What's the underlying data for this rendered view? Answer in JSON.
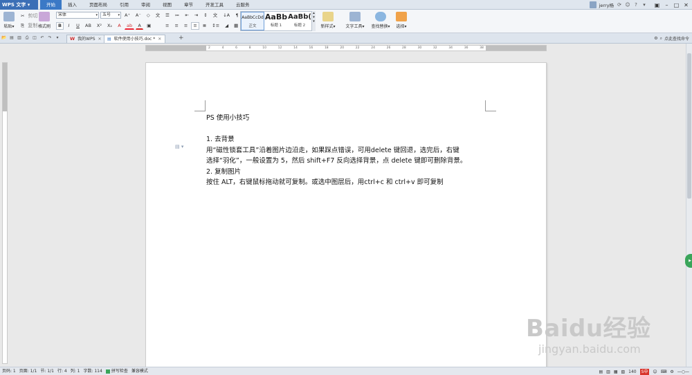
{
  "app": {
    "name": "WPS 文字"
  },
  "menu_tabs": [
    "开始",
    "插入",
    "页面布局",
    "引用",
    "审阅",
    "视图",
    "章节",
    "开发工具",
    "云服务"
  ],
  "title_right": {
    "user": "jerry杨"
  },
  "ribbon": {
    "paste": "粘贴",
    "cut": "剪切",
    "copy": "复制",
    "format_painter": "格式刷",
    "font_name": "宋体",
    "font_size": "五号",
    "styles": [
      {
        "preview": "AaBbCcDd",
        "name": "正文"
      },
      {
        "preview": "AaBb",
        "name": "标题 1"
      },
      {
        "preview": "AaBb(",
        "name": "标题 2"
      }
    ],
    "new_style": "新样式",
    "text_tools": "文字工具",
    "find_replace": "查找替换",
    "select": "选择"
  },
  "doc_tabs": [
    {
      "label": "我的WPS"
    },
    {
      "label": "软件使用小技巧.doc *"
    }
  ],
  "tabbar_right": {
    "search": "点此查找命令"
  },
  "document": {
    "title": "PS 使用小技巧",
    "lines": [
      "1.  去背景",
      "用“磁性锁套工具”沿着图片边沿走，如果踩点错误，可用delete 键回退，选完后，右键",
      "选择“羽化”，一般设置为 5，然后 shift+F7 反向选择背景，点 delete 键即可删除背景。",
      "2.  复制图片",
      "按住 ALT，右键鼠标拖动就可复制。或选中图层后，用ctrl+c 和 ctrl+v 即可复制"
    ]
  },
  "status": {
    "page_num": "页码: 1",
    "pages": "页面: 1/1",
    "section": "节: 1/1",
    "row": "行: 4",
    "col": "列: 1",
    "words": "字数: 114",
    "spell": "拼写检查",
    "compat": "兼容模式",
    "zoom": "140",
    "ime": "S中"
  },
  "watermark": {
    "brand": "Baidu经验",
    "url": "jingyan.baidu.com"
  },
  "colors": {
    "accent": "#3b79c6",
    "app_button": "#3b6fb6",
    "brand_red": "#d02a2a",
    "fab_green": "#3aa55a"
  }
}
